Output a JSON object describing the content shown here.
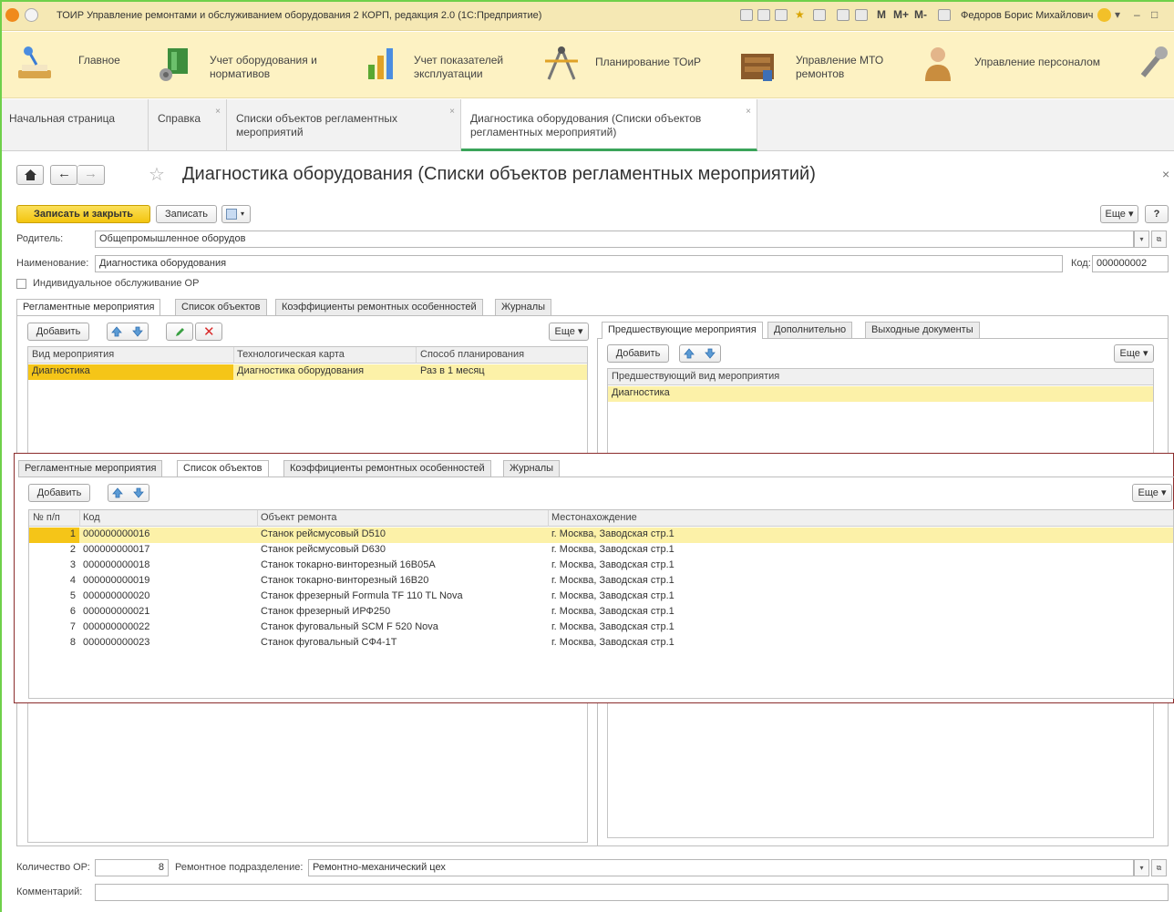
{
  "window": {
    "title": "ТОИР Управление ремонтами и обслуживанием оборудования 2 КОРП, редакция 2.0  (1С:Предприятие)",
    "toolbar_glyphs": [
      "M",
      "M+",
      "M-"
    ],
    "user": "Федоров Борис Михайлович"
  },
  "sections": [
    {
      "label": "Главное",
      "icon": "desk-lamp-icon"
    },
    {
      "label": "Учет оборудования и\nнормативов",
      "icon": "equipment-icon"
    },
    {
      "label": "Учет показателей\nэксплуатации",
      "icon": "chart-bars-icon"
    },
    {
      "label": "Планирование ТОиР",
      "icon": "drafting-tools-icon"
    },
    {
      "label": "Управление МТО\nремонтов",
      "icon": "warehouse-icon"
    },
    {
      "label": "Управление персоналом",
      "icon": "person-icon"
    }
  ],
  "page_tabs": [
    {
      "label": "Начальная страница",
      "closable": false
    },
    {
      "label": "Справка",
      "closable": true
    },
    {
      "label": "Списки объектов регламентных\nмероприятий",
      "closable": true
    },
    {
      "label": "Диагностика оборудования (Списки объектов\nрегламентных мероприятий)",
      "closable": true,
      "active": true
    }
  ],
  "form": {
    "title": "Диагностика оборудования (Списки объектов регламентных мероприятий)",
    "save_close": "Записать и закрыть",
    "save": "Записать",
    "more": "Еще",
    "help": "?",
    "parent_label": "Родитель:",
    "parent_value": "Общепромышленное оборудов",
    "name_label": "Наименование:",
    "name_value": "Диагностика оборудования",
    "code_label": "Код:",
    "code_value": "000000002",
    "individual_label": "Индивидуальное обслуживание ОР",
    "count_label": "Количество ОР:",
    "count_value": "8",
    "dept_label": "Ремонтное подразделение:",
    "dept_value": "Ремонтно-механический цех",
    "comment_label": "Комментарий:",
    "comment_value": ""
  },
  "inner_tabs": [
    "Регламентные мероприятия",
    "Список объектов",
    "Коэффициенты ремонтных особенностей",
    "Журналы"
  ],
  "left_grid": {
    "add": "Добавить",
    "more": "Еще",
    "headers": [
      "Вид мероприятия",
      "Технологическая карта",
      "Способ планирования"
    ],
    "rows": [
      [
        "Диагностика",
        "Диагностика оборудования",
        "Раз в 1 месяц"
      ]
    ]
  },
  "right_panel": {
    "tabs": [
      "Предшествующие мероприятия",
      "Дополнительно",
      "Выходные документы"
    ],
    "add": "Добавить",
    "more": "Еще",
    "header": "Предшествующий вид мероприятия",
    "rows": [
      "Диагностика"
    ]
  },
  "objects_grid": {
    "add": "Добавить",
    "more": "Еще",
    "headers": [
      "№ п/п",
      "Код",
      "Объект ремонта",
      "Местонахождение"
    ],
    "rows": [
      [
        "1",
        "000000000016",
        "Станок рейсмусовый D510",
        "г. Москва, Заводская стр.1"
      ],
      [
        "2",
        "000000000017",
        "Станок рейсмусовый D630",
        "г. Москва, Заводская стр.1"
      ],
      [
        "3",
        "000000000018",
        "Станок токарно-винторезный 16В05А",
        "г. Москва, Заводская стр.1"
      ],
      [
        "4",
        "000000000019",
        "Станок токарно-винторезный 16В20",
        "г. Москва, Заводская стр.1"
      ],
      [
        "5",
        "000000000020",
        "Станок фрезерный Formula TF 110 TL Nova",
        "г. Москва, Заводская стр.1"
      ],
      [
        "6",
        "000000000021",
        "Станок фрезерный ИРФ250",
        "г. Москва, Заводская стр.1"
      ],
      [
        "7",
        "000000000022",
        "Станок фуговальный SCM F 520 Nova",
        "г. Москва, Заводская стр.1"
      ],
      [
        "8",
        "000000000023",
        "Станок фуговальный СФ4-1Т",
        "г. Москва, Заводская стр.1"
      ]
    ]
  },
  "colors": {
    "accent_yellow": "#f3c50f",
    "selected_row": "#fcf1a8",
    "active_tab_underline": "#3aa45a",
    "overlay_border": "#8b2c2c"
  }
}
